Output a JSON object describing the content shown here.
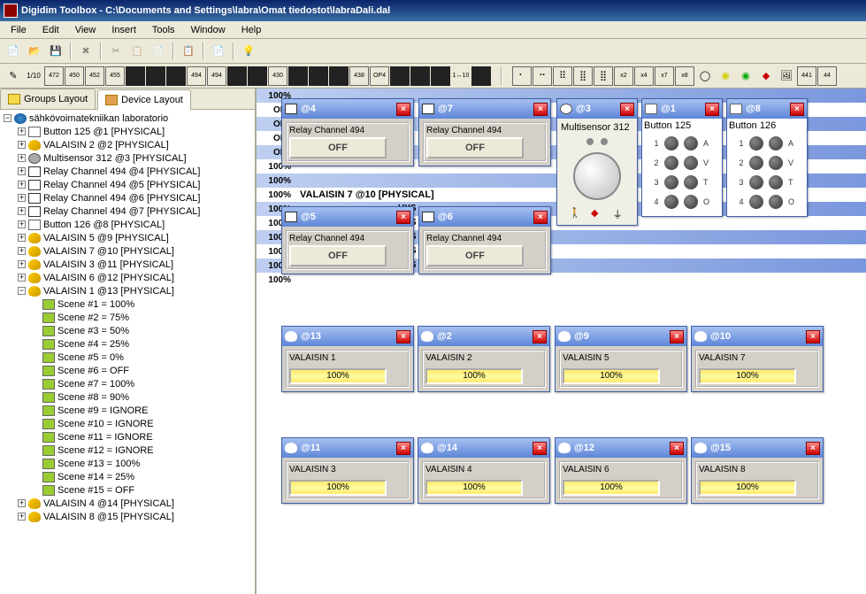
{
  "window": {
    "title": "Digidim Toolbox - C:\\Documents and Settings\\labra\\Omat tiedostot\\labraDali.dal"
  },
  "menu": [
    "File",
    "Edit",
    "View",
    "Insert",
    "Tools",
    "Window",
    "Help"
  ],
  "tabs": {
    "groups": "Groups Layout",
    "device": "Device Layout"
  },
  "tree": {
    "root": "sähkövoimatekniikan laboratorio",
    "items": [
      "Button 125 @1 [PHYSICAL]",
      "VALAISIN 2 @2 [PHYSICAL]",
      "Multisensor 312 @3 [PHYSICAL]",
      "Relay Channel 494 @4 [PHYSICAL]",
      "Relay Channel 494 @5 [PHYSICAL]",
      "Relay Channel 494 @6 [PHYSICAL]",
      "Relay Channel 494 @7 [PHYSICAL]",
      "Button 126 @8 [PHYSICAL]",
      "VALAISIN 5 @9 [PHYSICAL]",
      "VALAISIN 7 @10 [PHYSICAL]",
      "VALAISIN 3 @11 [PHYSICAL]",
      "VALAISIN 6 @12 [PHYSICAL]",
      "VALAISIN 1 @13 [PHYSICAL]"
    ],
    "scenes": [
      "Scene #1 = 100%",
      "Scene #2 = 75%",
      "Scene #3 = 50%",
      "Scene #4 = 25%",
      "Scene #5 = 0%",
      "Scene #6 = OFF",
      "Scene #7 = 100%",
      "Scene #8 = 90%",
      "Scene #9 = IGNORE",
      "Scene #10 = IGNORE",
      "Scene #11 = IGNORE",
      "Scene #12 = IGNORE",
      "Scene #13 = 100%",
      "Scene #14 = 25%",
      "Scene #15 = OFF"
    ],
    "tail": [
      "VALAISIN 4 @14 [PHYSICAL]",
      "VALAISIN 8 @15 [PHYSICAL]"
    ]
  },
  "stripes": [
    {
      "lvl": "100%",
      "lbl": "",
      "blue": true
    },
    {
      "lvl": "OFF",
      "lbl": "",
      "blue": false
    },
    {
      "lvl": "OFF",
      "lbl": "",
      "blue": true
    },
    {
      "lvl": "OFF",
      "lbl": "",
      "blue": false
    },
    {
      "lvl": "OFF",
      "lbl": "",
      "blue": true
    },
    {
      "lvl": "100%",
      "lbl": "",
      "blue": false
    },
    {
      "lvl": "100%",
      "lbl": "",
      "blue": true
    },
    {
      "lvl": "100%",
      "lbl": "VALAISIN 7 @10 [PHYSICAL]",
      "blue": false
    },
    {
      "lvl": "100%",
      "lbl": "",
      "blue": true
    },
    {
      "lvl": "100%",
      "lbl": "",
      "blue": false
    },
    {
      "lvl": "100%",
      "lbl": "",
      "blue": true
    },
    {
      "lvl": "100%",
      "lbl": "",
      "blue": false
    },
    {
      "lvl": "100%",
      "lbl": "",
      "blue": true
    },
    {
      "lvl": "100%",
      "lbl": "",
      "blue": false
    }
  ],
  "hys": [
    "HYS",
    "HYS",
    "HYS",
    "HYS",
    "HYS"
  ],
  "relays": [
    {
      "id": "@4",
      "name": "Relay Channel 494",
      "state": "OFF"
    },
    {
      "id": "@7",
      "name": "Relay Channel 494",
      "state": "OFF"
    },
    {
      "id": "@5",
      "name": "Relay Channel 494",
      "state": "OFF"
    },
    {
      "id": "@6",
      "name": "Relay Channel 494",
      "state": "OFF"
    }
  ],
  "multisensor": {
    "id": "@3",
    "name": "Multisensor 312"
  },
  "button125": {
    "id": "@1",
    "name": "Button 125"
  },
  "button126": {
    "id": "@8",
    "name": "Button 126"
  },
  "lamps": [
    {
      "id": "@13",
      "name": "VALAISIN 1",
      "level": "100%"
    },
    {
      "id": "@2",
      "name": "VALAISIN 2",
      "level": "100%"
    },
    {
      "id": "@9",
      "name": "VALAISIN 5",
      "level": "100%"
    },
    {
      "id": "@10",
      "name": "VALAISIN 7",
      "level": "100%"
    },
    {
      "id": "@11",
      "name": "VALAISIN 3",
      "level": "100%"
    },
    {
      "id": "@14",
      "name": "VALAISIN 4",
      "level": "100%"
    },
    {
      "id": "@12",
      "name": "VALAISIN 6",
      "level": "100%"
    },
    {
      "id": "@15",
      "name": "VALAISIN 8",
      "level": "100%"
    }
  ],
  "btnpanel": {
    "nums": [
      "1",
      "2",
      "3",
      "4"
    ],
    "letters": [
      "A",
      "V",
      "T",
      "O"
    ]
  }
}
